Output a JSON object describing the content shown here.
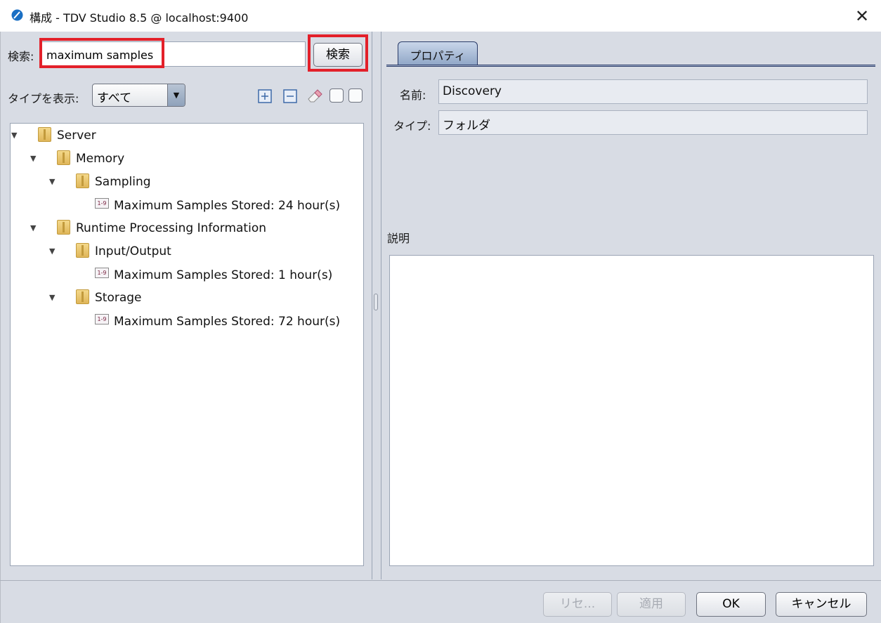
{
  "window": {
    "title": "構成 - TDV Studio 8.5 @ localhost:9400",
    "close_icon": "close-icon"
  },
  "search": {
    "label": "検索:",
    "value": "maximum samples",
    "button_label": "検索"
  },
  "filter": {
    "label": "タイプを表示:",
    "selected": "すべて"
  },
  "toolbar_icons": [
    "expand-all-icon",
    "collapse-all-icon",
    "eraser-icon",
    "checkbox-icon",
    "checkbox-icon"
  ],
  "tree": {
    "server": "Server",
    "memory": "Memory",
    "sampling": "Sampling",
    "sampling_leaf": "Maximum Samples Stored: 24 hour(s)",
    "runtime": "Runtime Processing Information",
    "io": "Input/Output",
    "io_leaf": "Maximum Samples Stored: 1 hour(s)",
    "storage": "Storage",
    "storage_leaf": "Maximum Samples Stored: 72 hour(s)"
  },
  "properties": {
    "tab_label": "プロパティ",
    "name_label": "名前:",
    "name_value": "Discovery",
    "type_label": "タイプ:",
    "type_value": "フォルダ",
    "description_label": "説明"
  },
  "footer": {
    "reset_label": "リセ...",
    "apply_label": "適用",
    "ok_label": "OK",
    "cancel_label": "キャンセル"
  },
  "colors": {
    "highlight_box": "#e3202a",
    "tab_accent": "#2a3b68",
    "panel_bg": "#d8dce4"
  }
}
